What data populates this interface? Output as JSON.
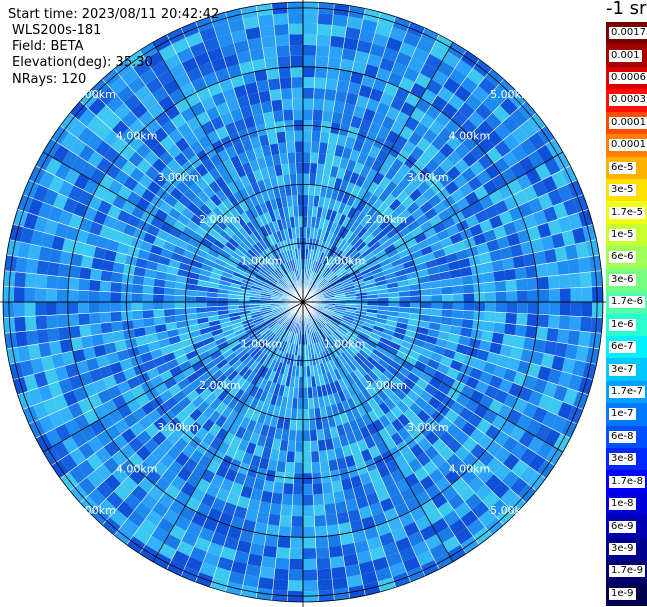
{
  "header": {
    "start_time": "Start time: 2023/08/11 20:42:42",
    "instrument": "WLS200s-181",
    "field": "Field: BETA",
    "elevation": "Elevation(deg): 35.30",
    "nrays": "NRays: 120"
  },
  "chart_data": {
    "type": "heatmap",
    "projection": "polar-ppi",
    "field": "BETA",
    "n_rays": 120,
    "range_rings_km": [
      1.0,
      2.0,
      3.0,
      4.0,
      5.0
    ],
    "range_label_text": [
      "1.00km",
      "2.00km",
      "3.00km",
      "4.00km",
      "5.00km"
    ],
    "max_range_km": 5.0,
    "colorbar": {
      "title": "-1 sr",
      "labels": [
        "0.0017",
        "0.001",
        "0.0006",
        "0.0003",
        "0.00017",
        "0.0001",
        "6e-5",
        "3e-5",
        "1.7e-5",
        "1e-5",
        "6e-6",
        "3e-6",
        "1.7e-6",
        "1e-6",
        "6e-7",
        "3e-7",
        "1.7e-7",
        "1e-7",
        "6e-8",
        "3e-8",
        "1.7e-8",
        "1e-8",
        "6e-9",
        "3e-9",
        "1.7e-9",
        "1e-9"
      ],
      "colors": [
        "#7a0000",
        "#a50000",
        "#d80000",
        "#ff1000",
        "#ff4a00",
        "#ff8000",
        "#ffb000",
        "#ffe000",
        "#eeff10",
        "#c8ff30",
        "#a0ff58",
        "#78ff80",
        "#50ffa8",
        "#28ffd0",
        "#00f0ff",
        "#00c8ff",
        "#00a0ff",
        "#0078ff",
        "#0050ff",
        "#0028ff",
        "#0000ff",
        "#0000d8",
        "#0000b0",
        "#000090",
        "#000070",
        "#000050"
      ]
    },
    "dominant_color": "#1e8cf0"
  }
}
